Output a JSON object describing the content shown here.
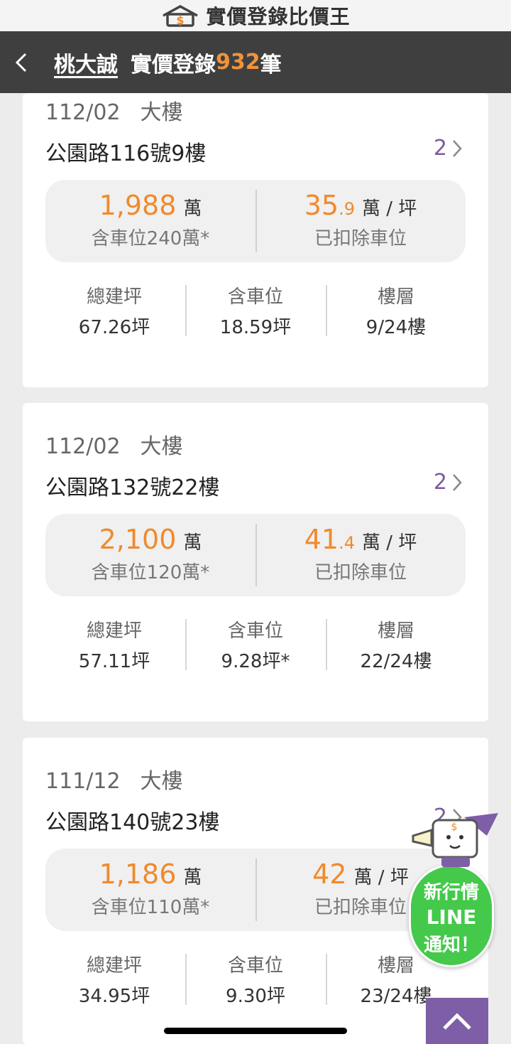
{
  "app": {
    "brand_title": "實價登錄比價王"
  },
  "nav": {
    "community": "桃大誠",
    "title_prefix": "實價登錄",
    "count": "932",
    "title_suffix": "筆"
  },
  "listings": [
    {
      "date": "112/02",
      "type": "大樓",
      "address": "公園路116號9樓",
      "more_count": "2",
      "total_price": "1,988",
      "total_unit": "萬",
      "parking_note": "含車位240萬*",
      "unit_price_int": "35",
      "unit_price_dec": ".9",
      "unit_price_unit": "萬 / 坪",
      "unit_note": "已扣除車位",
      "stats": [
        {
          "label": "總建坪",
          "value": "67.26坪"
        },
        {
          "label": "含車位",
          "value": "18.59坪"
        },
        {
          "label": "樓層",
          "value": "9/24樓"
        }
      ]
    },
    {
      "date": "112/02",
      "type": "大樓",
      "address": "公園路132號22樓",
      "more_count": "2",
      "total_price": "2,100",
      "total_unit": "萬",
      "parking_note": "含車位120萬*",
      "unit_price_int": "41",
      "unit_price_dec": ".4",
      "unit_price_unit": "萬 / 坪",
      "unit_note": "已扣除車位",
      "stats": [
        {
          "label": "總建坪",
          "value": "57.11坪"
        },
        {
          "label": "含車位",
          "value": "9.28坪*"
        },
        {
          "label": "樓層",
          "value": "22/24樓"
        }
      ]
    },
    {
      "date": "111/12",
      "type": "大樓",
      "address": "公園路140號23樓",
      "more_count": "2",
      "total_price": "1,186",
      "total_unit": "萬",
      "parking_note": "含車位110萬*",
      "unit_price_int": "42",
      "unit_price_dec": "",
      "unit_price_unit": "萬 / 坪",
      "unit_note": "已扣除車位",
      "stats": [
        {
          "label": "總建坪",
          "value": "34.95坪"
        },
        {
          "label": "含車位",
          "value": "9.30坪"
        },
        {
          "label": "樓層",
          "value": "23/24樓"
        }
      ]
    }
  ],
  "line_promo": {
    "line1": "新行情",
    "line2": "LINE",
    "line3": "通知！"
  },
  "colors": {
    "accent_orange": "#f08a2c",
    "purple": "#7e5ea6",
    "line_green": "#44c94b",
    "navbar": "#3f3f3f"
  },
  "icons": [
    "house-logo-icon",
    "back-arrow-icon",
    "chevron-right-icon",
    "mascot-icon",
    "chevron-up-icon"
  ]
}
